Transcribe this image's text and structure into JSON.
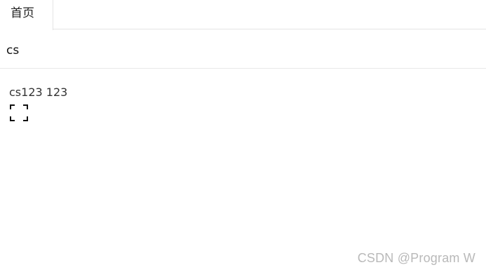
{
  "tabs": [
    {
      "label": "首页"
    }
  ],
  "header": {
    "title": "cs"
  },
  "content": {
    "text": "cs123 123",
    "action_icon": "fullscreen-icon"
  },
  "watermark": {
    "text": "CSDN @Program W"
  }
}
